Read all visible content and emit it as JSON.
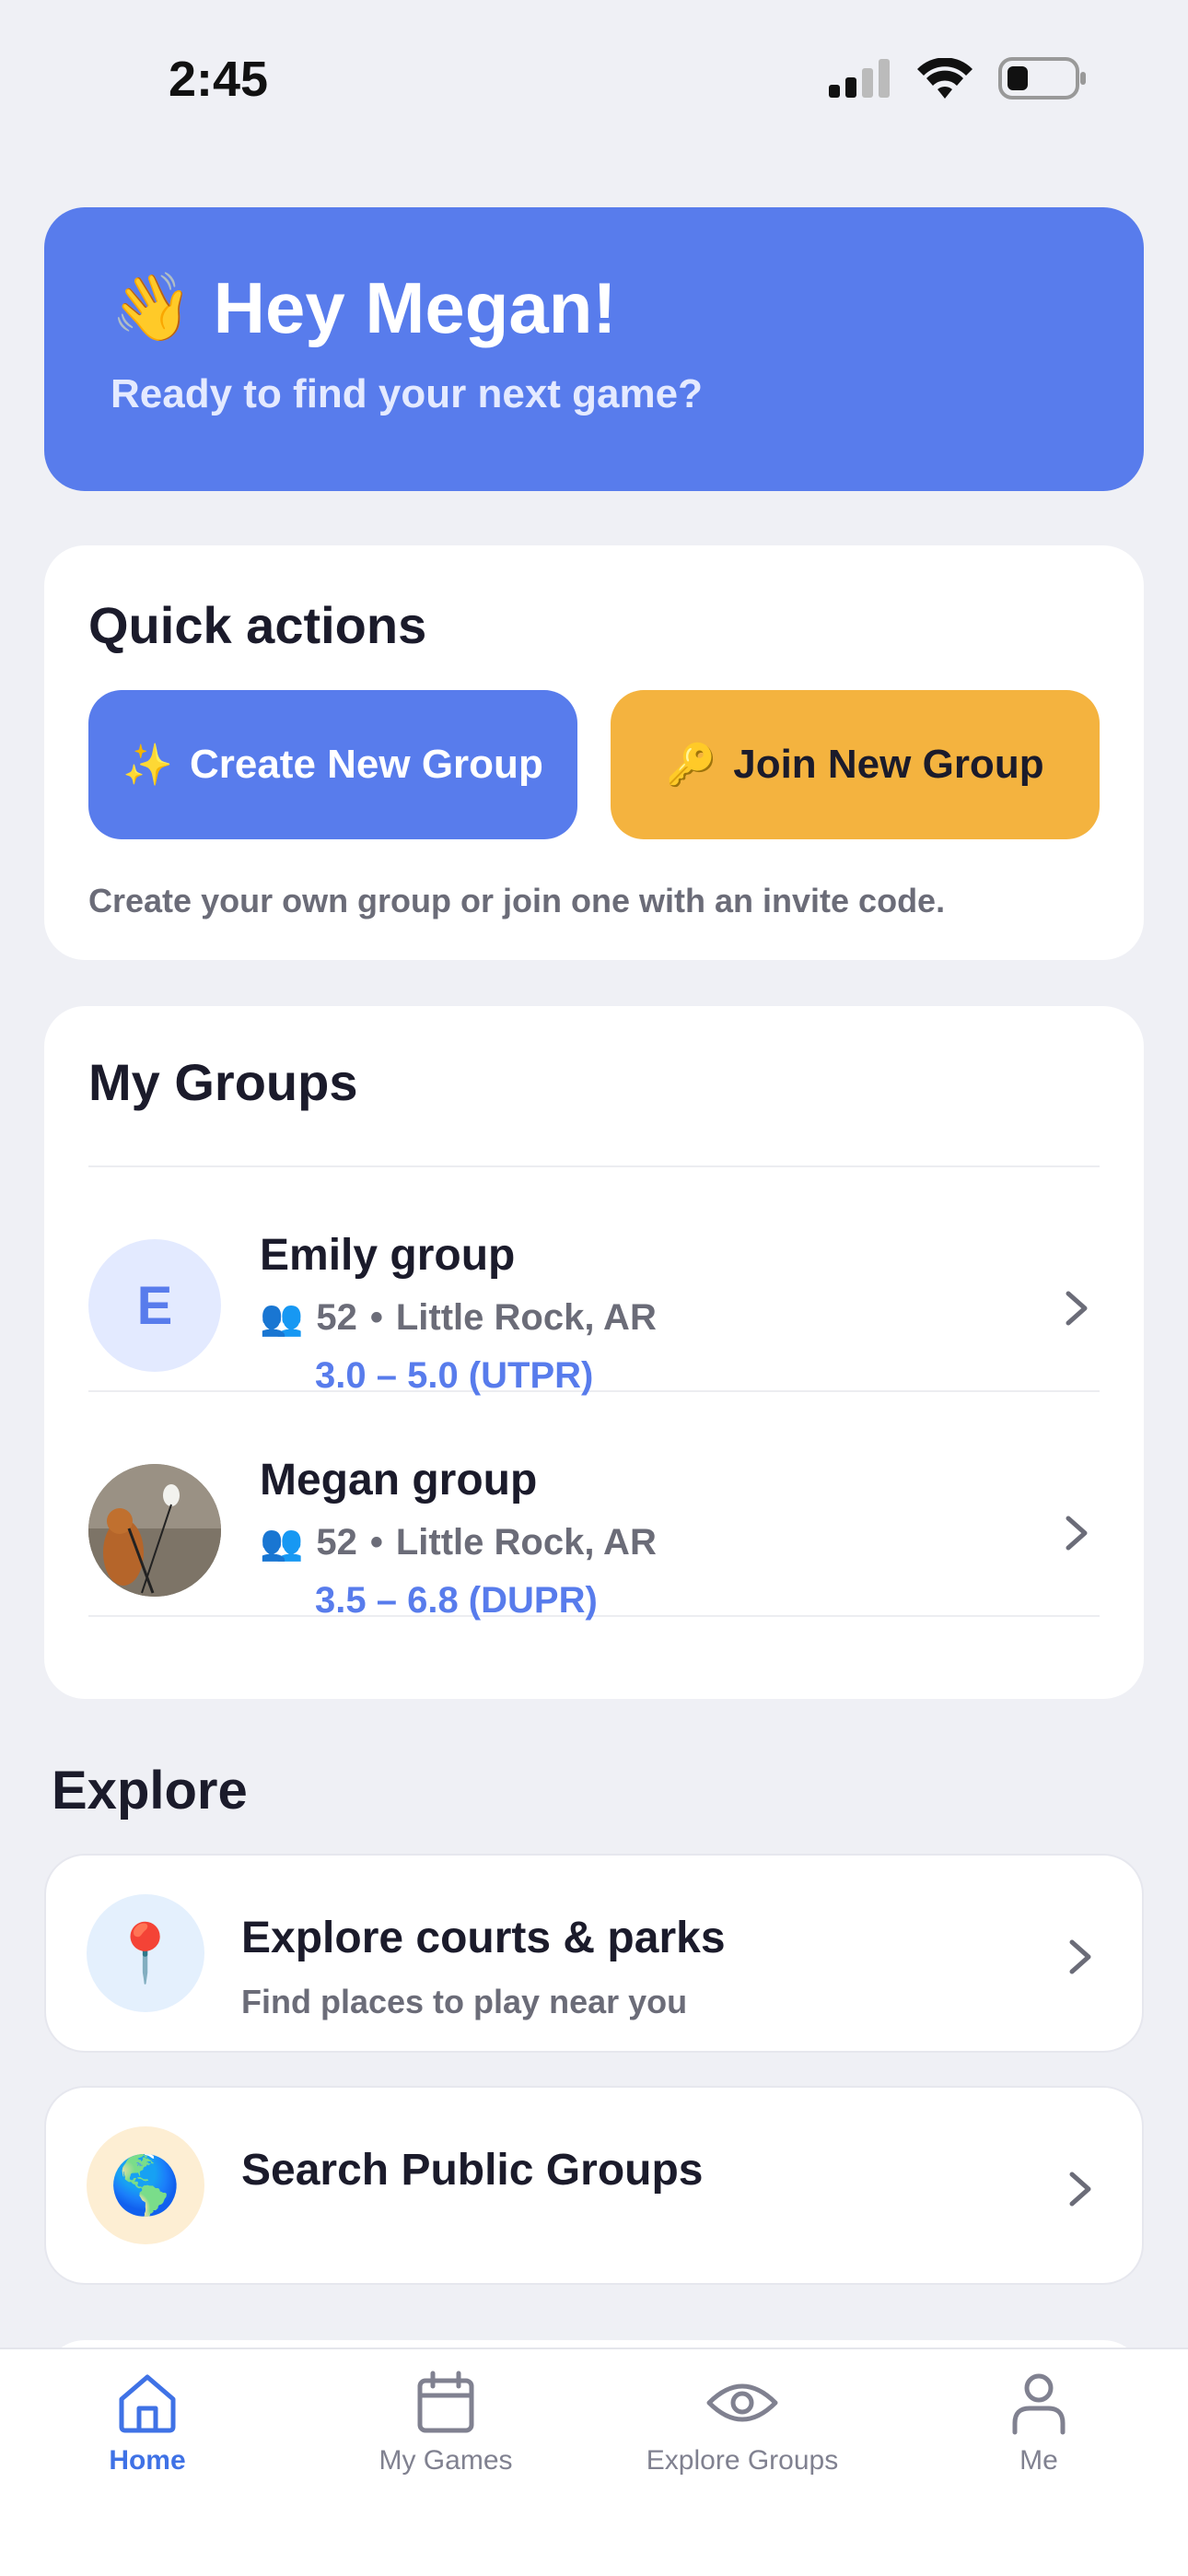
{
  "status": {
    "time": "2:45"
  },
  "hero": {
    "emoji": "👋",
    "title": "Hey Megan!",
    "subtitle": "Ready to find your next game?",
    "color": "#587cec"
  },
  "quick_actions": {
    "title": "Quick actions",
    "create": {
      "emoji": "✨",
      "label": "Create New Group"
    },
    "join": {
      "emoji": "🔑",
      "label": "Join New Group"
    },
    "hint": "Create your own group or join one with an invite code."
  },
  "my_groups": {
    "title": "My Groups",
    "items": [
      {
        "initial": "E",
        "name": "Emily group",
        "members": "52",
        "location": "Little Rock, AR",
        "range": "3.0 – 5.0 (UTPR)"
      },
      {
        "initial": "",
        "name": "Megan group",
        "members": "52",
        "location": "Little Rock, AR",
        "range": "3.5 – 6.8 (DUPR)"
      }
    ]
  },
  "explore": {
    "title": "Explore",
    "items": [
      {
        "icon": "📍",
        "title": "Explore courts & parks",
        "subtitle": "Find places to play near you"
      },
      {
        "icon": "🌎",
        "title": "Search Public Groups",
        "subtitle": ""
      }
    ]
  },
  "tabs": [
    {
      "label": "Home",
      "icon": "home-icon",
      "active": true
    },
    {
      "label": "My Games",
      "icon": "calendar-icon",
      "active": false
    },
    {
      "label": "Explore Groups",
      "icon": "eye-icon",
      "active": false
    },
    {
      "label": "Me",
      "icon": "person-icon",
      "active": false
    }
  ],
  "colors": {
    "accent": "#587cec",
    "join": "#f4b33f",
    "tab_active": "#3f72e6"
  }
}
